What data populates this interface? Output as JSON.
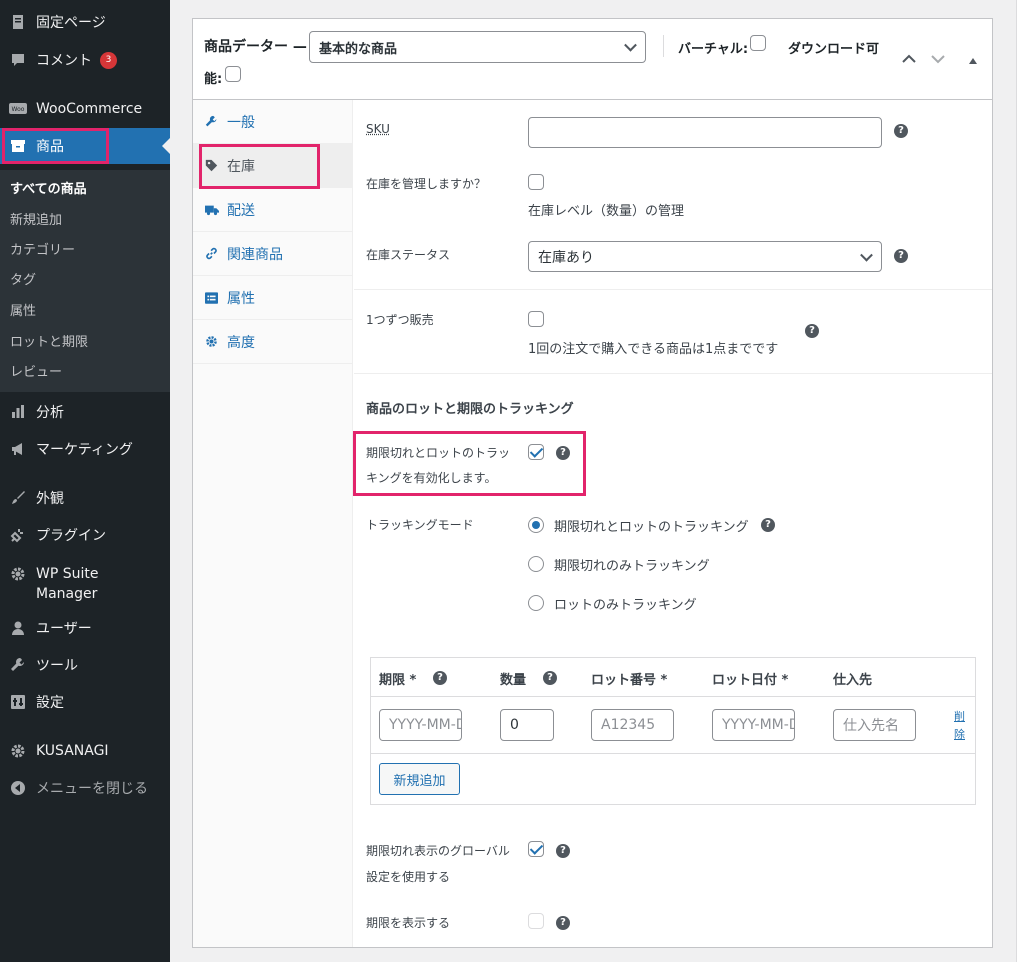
{
  "sidebar": {
    "items": [
      {
        "label": "固定ページ",
        "icon": "page-icon"
      },
      {
        "label": "コメント",
        "icon": "comment-icon",
        "badge": "3"
      },
      {
        "label": "WooCommerce",
        "icon": "woocommerce-icon"
      },
      {
        "label": "商品",
        "icon": "archive-icon"
      },
      {
        "label": "分析",
        "icon": "bar-chart-icon"
      },
      {
        "label": "マーケティング",
        "icon": "megaphone-icon"
      },
      {
        "label": "外観",
        "icon": "paintbrush-icon"
      },
      {
        "label": "プラグイン",
        "icon": "plugin-icon"
      },
      {
        "label": "WP Suite\nManager",
        "icon": "gear-icon"
      },
      {
        "label": "ユーザー",
        "icon": "user-icon"
      },
      {
        "label": "ツール",
        "icon": "wrench-icon"
      },
      {
        "label": "設定",
        "icon": "settings-icon"
      },
      {
        "label": "KUSANAGI",
        "icon": "gear-icon"
      },
      {
        "label": "メニューを閉じる",
        "icon": "collapse-icon"
      }
    ],
    "submenu": [
      "すべての商品",
      "新規追加",
      "カテゴリー",
      "タグ",
      "属性",
      "ロットと期限",
      "レビュー"
    ]
  },
  "header": {
    "title": "商品データー —",
    "product_type": "基本的な商品",
    "virtual_label": "バーチャル:",
    "downloadable_label": "ダウンロード可",
    "downloadable_label_wrap": "能:"
  },
  "tabs": [
    {
      "label": "一般",
      "icon": "wrench-icon"
    },
    {
      "label": "在庫",
      "icon": "tag-icon"
    },
    {
      "label": "配送",
      "icon": "truck-icon"
    },
    {
      "label": "関連商品",
      "icon": "link-icon"
    },
    {
      "label": "属性",
      "icon": "list-icon"
    },
    {
      "label": "高度",
      "icon": "gear-icon"
    }
  ],
  "inventory": {
    "sku_label": "SKU",
    "sku_value": "",
    "manage_stock_label": "在庫を管理しますか？",
    "manage_stock_desc": "在庫レベル（数量）の管理",
    "stock_status_label": "在庫ステータス",
    "stock_status_value": "在庫あり",
    "sold_individually_label": "1つずつ販売",
    "sold_individually_desc": "1回の注文で購入できる商品は1点までです"
  },
  "tracking": {
    "section_title": "商品のロットと期限のトラッキング",
    "enable_label_line1": "期限切れとロットのトラッ",
    "enable_label_line2": "キングを有効化します。",
    "mode_label": "トラッキングモード",
    "modes": [
      "期限切れとロットのトラッキング",
      "期限切れのみトラッキング",
      "ロットのみトラッキング"
    ],
    "selected_mode": 0
  },
  "lot_table": {
    "headers": [
      "期限 *",
      "数量",
      "ロット番号 *",
      "ロット日付 *",
      "仕入先"
    ],
    "row": {
      "expiry_placeholder": "YYYY-MM-DD",
      "quantity": "0",
      "lot_number_placeholder": "A12345",
      "lot_date_placeholder": "YYYY-MM-DD",
      "supplier_placeholder": "仕入先名",
      "delete_label": "削除"
    },
    "add_button": "新規追加"
  },
  "global": {
    "use_global_line1": "期限切れ表示のグローバル",
    "use_global_line2": "設定を使用する",
    "show_expiry_label": "期限を表示する"
  },
  "colors": {
    "accent": "#2271b1",
    "highlight": "#e2246b",
    "sidebar": "#1d2327",
    "badge": "#d63638"
  }
}
